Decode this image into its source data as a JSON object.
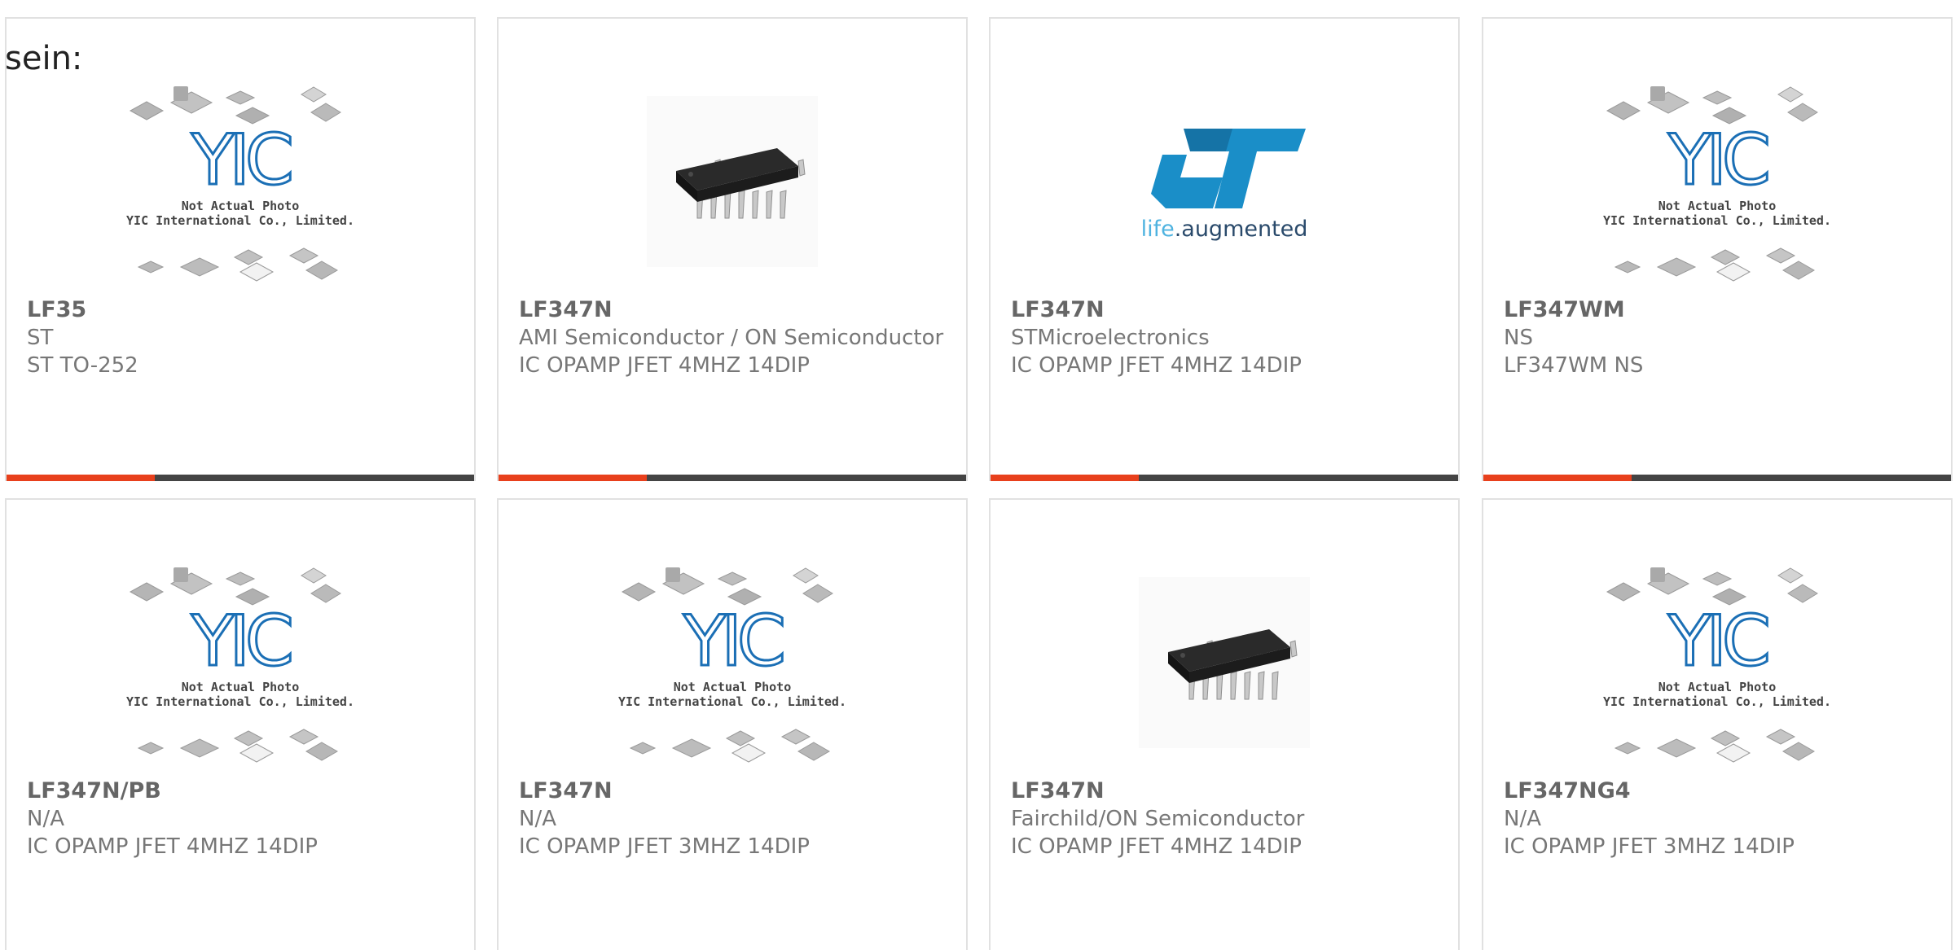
{
  "intro": {
    "text": "sein:"
  },
  "placeholder_image": {
    "line1": "Not Actual Photo",
    "line2": "YIC International Co., Limited.",
    "logo_text": "YIC"
  },
  "st_logo": {
    "brand": "ST",
    "tagline_1": "life",
    "tagline_2": ".augmented"
  },
  "colors": {
    "accent_bar": "#e8401c",
    "bar_dark": "#444444",
    "st_blue": "#1a8ec8",
    "yic_blue": "#1b6fb5"
  },
  "products": [
    {
      "part": "LF35",
      "manufacturer": "ST",
      "description": "ST TO-252",
      "image": "yic-placeholder"
    },
    {
      "part": "LF347N",
      "manufacturer": "AMI Semiconductor / ON Semiconductor",
      "description": "IC OPAMP JFET 4MHZ 14DIP",
      "image": "dip14-chip"
    },
    {
      "part": "LF347N",
      "manufacturer": "STMicroelectronics",
      "description": "IC OPAMP JFET 4MHZ 14DIP",
      "image": "st-logo"
    },
    {
      "part": "LF347WM",
      "manufacturer": "NS",
      "description": "LF347WM NS",
      "image": "yic-placeholder"
    },
    {
      "part": "LF347N/PB",
      "manufacturer": "N/A",
      "description": "IC OPAMP JFET 4MHZ 14DIP",
      "image": "yic-placeholder"
    },
    {
      "part": "LF347N",
      "manufacturer": "N/A",
      "description": "IC OPAMP JFET 3MHZ 14DIP",
      "image": "yic-placeholder"
    },
    {
      "part": "LF347N",
      "manufacturer": "Fairchild/ON Semiconductor",
      "description": "IC OPAMP JFET 4MHZ 14DIP",
      "image": "dip14-chip"
    },
    {
      "part": "LF347NG4",
      "manufacturer": "N/A",
      "description": "IC OPAMP JFET 3MHZ 14DIP",
      "image": "yic-placeholder"
    }
  ]
}
